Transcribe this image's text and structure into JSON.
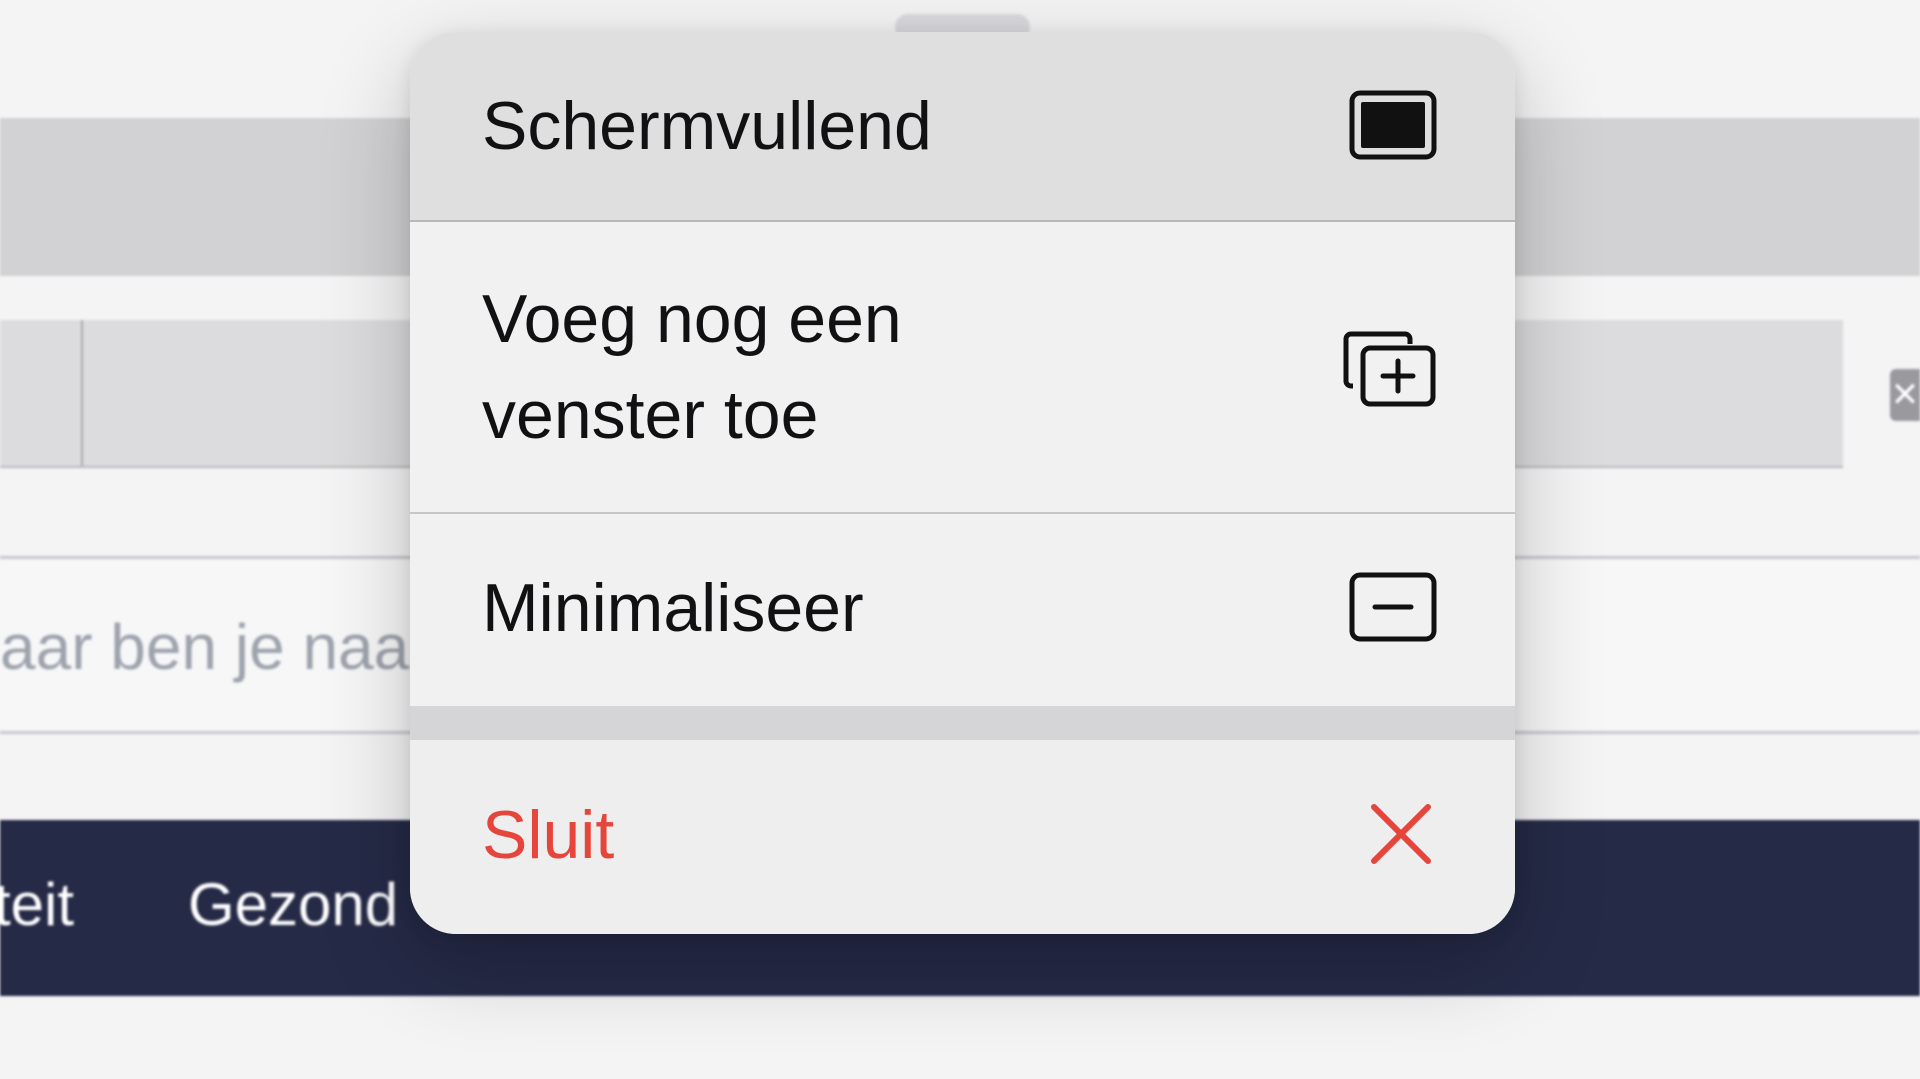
{
  "background": {
    "search_text": "aar ben je naa",
    "nav_items": [
      "teit",
      "Gezond"
    ],
    "tab_close_glyph": "✕"
  },
  "menu": {
    "items": [
      {
        "label": "Schermvullend",
        "icon": "fullscreen-icon"
      },
      {
        "label": "Voeg nog een venster toe",
        "icon": "add-window-icon"
      },
      {
        "label": "Minimaliseer",
        "icon": "minimize-icon"
      },
      {
        "label": "Sluit",
        "icon": "close-icon",
        "color": "#e5453a"
      }
    ]
  }
}
